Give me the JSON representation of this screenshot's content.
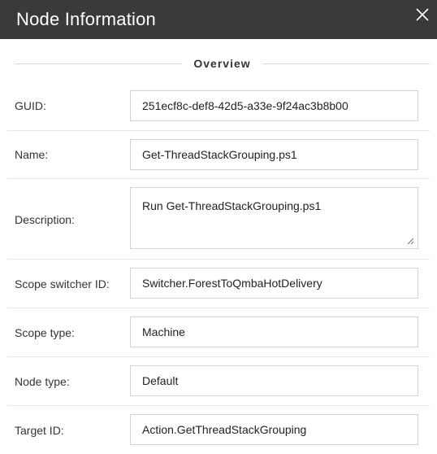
{
  "dialog": {
    "title": "Node Information",
    "close_icon": "close-icon"
  },
  "section": {
    "title": "Overview"
  },
  "fields": [
    {
      "label": "GUID:",
      "value": "251ecf8c-def8-42d5-a33e-9f24ac3b8b00"
    },
    {
      "label": "Name:",
      "value": "Get-ThreadStackGrouping.ps1"
    },
    {
      "label": "Description:",
      "value": "Run Get-ThreadStackGrouping.ps1"
    },
    {
      "label": "Scope switcher ID:",
      "value": "Switcher.ForestToQmbaHotDelivery"
    },
    {
      "label": "Scope type:",
      "value": "Machine"
    },
    {
      "label": "Node type:",
      "value": "Default"
    },
    {
      "label": "Target ID:",
      "value": "Action.GetThreadStackGrouping"
    }
  ]
}
